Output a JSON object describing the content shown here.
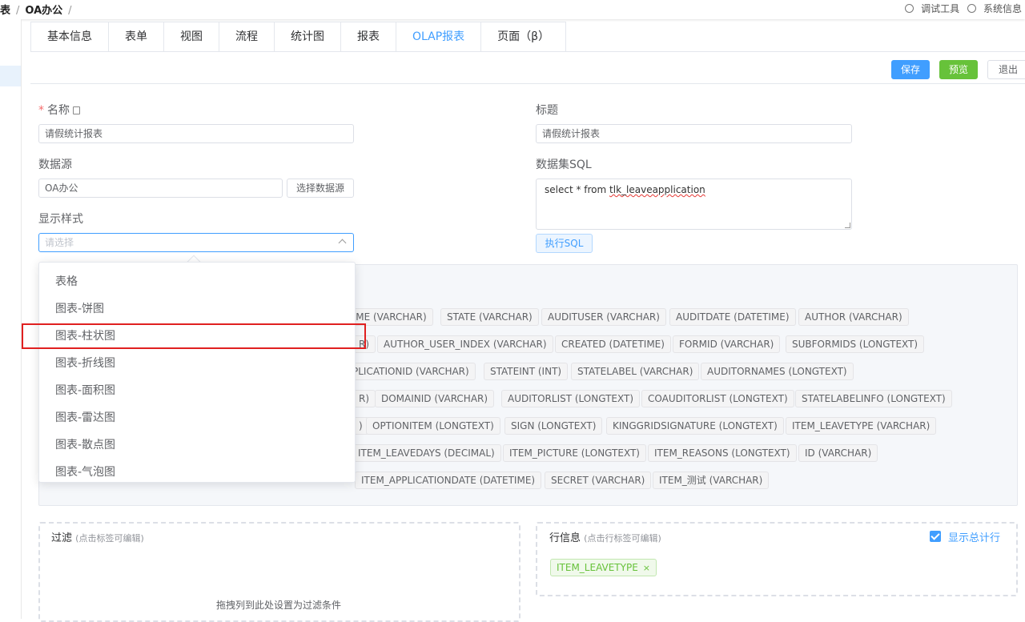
{
  "breadcrumb": {
    "item1": "表",
    "item2": "OA办公",
    "sep": "/"
  },
  "toplinks": {
    "debug": "调试工具",
    "sysinfo": "系统信息"
  },
  "tabs": [
    {
      "label": "基本信息"
    },
    {
      "label": "表单"
    },
    {
      "label": "视图"
    },
    {
      "label": "流程"
    },
    {
      "label": "统计图"
    },
    {
      "label": "报表"
    },
    {
      "label": "OLAP报表"
    },
    {
      "label": "页面（β）"
    }
  ],
  "active_tab": "OLAP报表",
  "toolbar": {
    "save": "保存",
    "preview": "预览",
    "exit": "退出"
  },
  "form": {
    "name_label": "名称",
    "name_value": "请假统计报表",
    "title_label": "标题",
    "title_value": "请假统计报表",
    "datasource_label": "数据源",
    "datasource_value": "OA办公",
    "choose_datasource": "选择数据源",
    "dataset_sql_label": "数据集SQL",
    "sql_prefix": "select * from ",
    "sql_table": "tlk_leaveapplication",
    "exec_sql": "执行SQL",
    "style_label": "显示样式",
    "style_placeholder": "请选择"
  },
  "style_options": [
    "表格",
    "图表-饼图",
    "图表-柱状图",
    "图表-折线图",
    "图表-面积图",
    "图表-雷达图",
    "图表-散点图",
    "图表-气泡图"
  ],
  "highlighted_option": "图表-柱状图",
  "columns": [
    "AME (VARCHAR)",
    "STATE (VARCHAR)",
    "AUDITUSER (VARCHAR)",
    "AUDITDATE (DATETIME)",
    "AUTHOR (VARCHAR)",
    "R)",
    "AUTHOR_USER_INDEX (VARCHAR)",
    "CREATED (DATETIME)",
    "FORMID (VARCHAR)",
    "SUBFORMIDS (LONGTEXT)",
    "PLICATIONID (VARCHAR)",
    "STATEINT (INT)",
    "STATELABEL (VARCHAR)",
    "AUDITORNAMES (LONGTEXT)",
    "R)",
    "DOMAINID (VARCHAR)",
    "AUDITORLIST (LONGTEXT)",
    "COAUDITORLIST (LONGTEXT)",
    "STATELABELINFO (LONGTEXT)",
    ")",
    "OPTIONITEM (LONGTEXT)",
    "SIGN (LONGTEXT)",
    "KINGGRIDSIGNATURE (LONGTEXT)",
    "ITEM_LEAVETYPE (VARCHAR)",
    "ITEM_LEAVEDAYS (DECIMAL)",
    "ITEM_PICTURE (LONGTEXT)",
    "ITEM_REASONS (LONGTEXT)",
    "ID (VARCHAR)",
    "ITEM_APPLICATIONDATE (DATETIME)",
    "SECRET (VARCHAR)",
    "ITEM_测试 (VARCHAR)"
  ],
  "filter": {
    "title": "过滤",
    "hint": "(点击标签可编辑)",
    "drop_hint": "拖拽列到此处设置为过滤条件"
  },
  "rowinfo": {
    "title": "行信息",
    "hint": "(点击行标签可编辑)",
    "show_total": "显示总计行",
    "tag": "ITEM_LEAVETYPE",
    "tag_close": "×"
  }
}
